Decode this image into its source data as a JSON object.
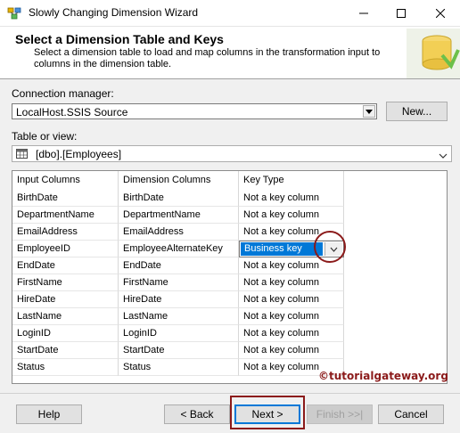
{
  "window": {
    "title": "Slowly Changing Dimension Wizard"
  },
  "header": {
    "title": "Select a Dimension Table and Keys",
    "description": "Select a dimension table to load and map columns in the transformation input to columns in the dimension table."
  },
  "connection": {
    "label": "Connection manager:",
    "value": "LocalHost.SSIS Source",
    "new_button": "New..."
  },
  "table": {
    "label": "Table or view:",
    "value": "[dbo].[Employees]"
  },
  "grid": {
    "headers": [
      "Input Columns",
      "Dimension Columns",
      "Key Type"
    ],
    "rows": [
      {
        "input": "BirthDate",
        "dimension": "BirthDate",
        "key": "Not a key column"
      },
      {
        "input": "DepartmentName",
        "dimension": "DepartmentName",
        "key": "Not a key column"
      },
      {
        "input": "EmailAddress",
        "dimension": "EmailAddress",
        "key": "Not a key column"
      },
      {
        "input": "EmployeeID",
        "dimension": "EmployeeAlternateKey",
        "key": "Business key"
      },
      {
        "input": "EndDate",
        "dimension": "EndDate",
        "key": "Not a key column"
      },
      {
        "input": "FirstName",
        "dimension": "FirstName",
        "key": "Not a key column"
      },
      {
        "input": "HireDate",
        "dimension": "HireDate",
        "key": "Not a key column"
      },
      {
        "input": "LastName",
        "dimension": "LastName",
        "key": "Not a key column"
      },
      {
        "input": "LoginID",
        "dimension": "LoginID",
        "key": "Not a key column"
      },
      {
        "input": "StartDate",
        "dimension": "StartDate",
        "key": "Not a key column"
      },
      {
        "input": "Status",
        "dimension": "Status",
        "key": "Not a key column"
      }
    ]
  },
  "watermark": "©tutorialgateway.org",
  "buttons": {
    "help": "Help",
    "back": "< Back",
    "next": "Next >",
    "finish": "Finish >>|",
    "cancel": "Cancel"
  }
}
